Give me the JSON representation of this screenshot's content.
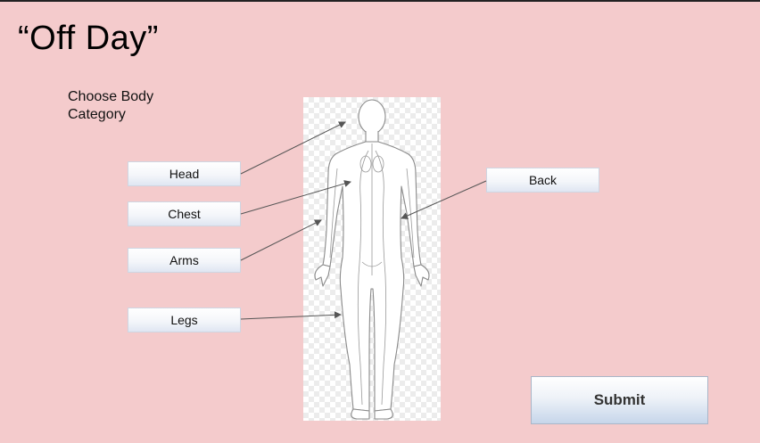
{
  "title": "“Off Day”",
  "subtitle": "Choose Body Category",
  "categories": {
    "head": "Head",
    "chest": "Chest",
    "arms": "Arms",
    "legs": "Legs",
    "back": "Back"
  },
  "submit_label": "Submit",
  "colors": {
    "background": "#f4cbcc",
    "button_gradient_end": "#dfe6f2",
    "arrow": "#555555"
  },
  "icons": {
    "figure": "human-anatomy-diagram"
  }
}
